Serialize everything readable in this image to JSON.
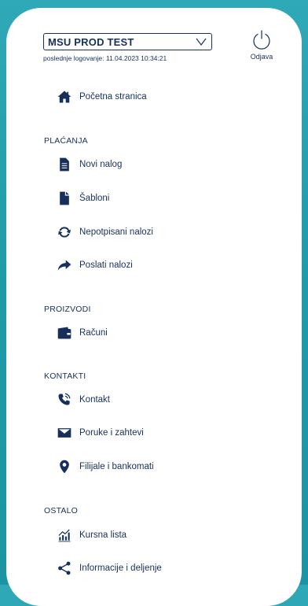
{
  "header": {
    "profile_value": "MSU PROD TEST",
    "last_login": "poslednje logovanje: 11.04.2023 10:34:21",
    "logout_label": "Odjava"
  },
  "menu": {
    "home_label": "Početna stranica",
    "sections": {
      "payments": {
        "title": "PLAĆANJA",
        "items": [
          "Novi nalog",
          "Šabloni",
          "Nepotpisani nalozi",
          "Poslati nalozi"
        ]
      },
      "products": {
        "title": "PROIZVODI",
        "items": [
          "Računi"
        ]
      },
      "contacts": {
        "title": "KONTAKTI",
        "items": [
          "Kontakt",
          "Poruke i zahtevi",
          "Filijale i bankomati"
        ]
      },
      "other": {
        "title": "OSTALO",
        "items": [
          "Kursna lista",
          "Informacije i deljenje"
        ]
      }
    }
  },
  "colors": {
    "background": "#1f9aa9",
    "text": "#16305b",
    "panel": "#ffffff"
  }
}
